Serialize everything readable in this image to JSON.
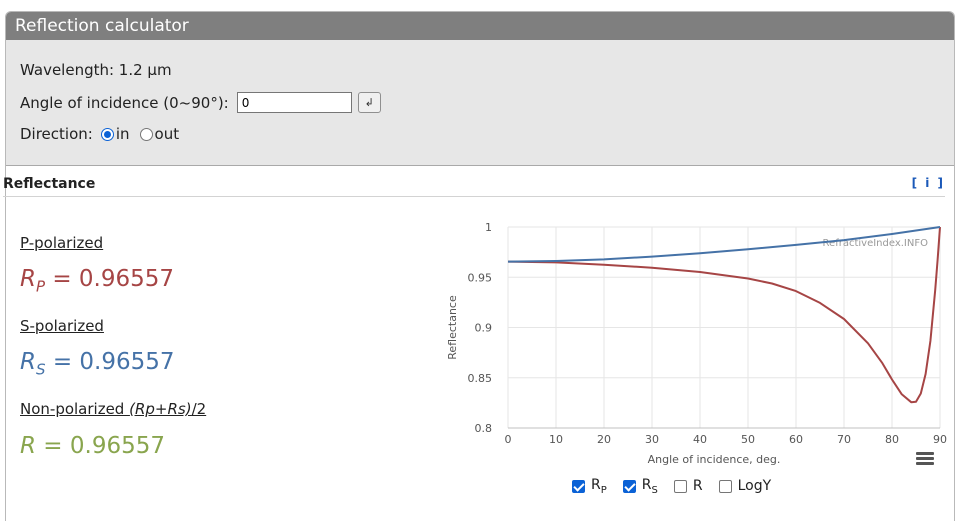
{
  "window": {
    "title": "Reflection calculator"
  },
  "params": {
    "wavelength_label": "Wavelength: 1.2 µm",
    "angle_label": "Angle of incidence (0~90°):",
    "angle_value": "0",
    "enter_symbol": "↲",
    "direction_label": "Direction:",
    "direction_options": [
      "in",
      "out"
    ],
    "direction_selected": "in"
  },
  "reflectance": {
    "title": "Reflectance",
    "info": "[ i ]",
    "p_label": "P-polarized",
    "p_symbol": "R",
    "p_sub": "P",
    "p_value": "= 0.96557",
    "s_label": "S-polarized",
    "s_symbol": "R",
    "s_sub": "S",
    "s_value": "= 0.96557",
    "n_label_prefix": "Non-polarized ",
    "n_label_formula": "(Rp+Rs)",
    "n_label_suffix": "/2",
    "n_symbol": "R",
    "n_value": "= 0.96557"
  },
  "legend": {
    "rp_main": "R",
    "rp_sub": "P",
    "rp_checked": true,
    "rs_main": "R",
    "rs_sub": "S",
    "rs_checked": true,
    "r_label": "R",
    "r_checked": false,
    "logy_label": "LogY",
    "logy_checked": false
  },
  "colors": {
    "p": "#a64545",
    "s": "#4572a7",
    "r": "#89a54e"
  },
  "chart_data": {
    "type": "line",
    "xlabel": "Angle of incidence, deg.",
    "ylabel": "Reflectance",
    "watermark": "RefractiveIndex.INFO",
    "xlim": [
      0,
      90
    ],
    "ylim": [
      0.8,
      1
    ],
    "xticks": [
      0,
      10,
      20,
      30,
      40,
      50,
      60,
      70,
      80,
      90
    ],
    "yticks": [
      0.8,
      0.85,
      0.9,
      0.95,
      1
    ],
    "ytick_labels": [
      "0.8",
      "0.85",
      "0.9",
      "0.95",
      "1"
    ],
    "grid": true,
    "series": [
      {
        "name": "Rp",
        "color": "#a64545",
        "x": [
          0,
          10,
          20,
          30,
          40,
          50,
          55,
          60,
          65,
          70,
          75,
          78,
          80,
          82,
          84,
          85,
          86,
          87,
          88,
          89,
          89.5,
          90
        ],
        "y": [
          0.9656,
          0.9648,
          0.9625,
          0.9595,
          0.9552,
          0.9488,
          0.9438,
          0.9362,
          0.9245,
          0.9085,
          0.8843,
          0.8645,
          0.8483,
          0.8337,
          0.8257,
          0.8262,
          0.8343,
          0.8537,
          0.8866,
          0.9372,
          0.9672,
          1.0
        ]
      },
      {
        "name": "Rs",
        "color": "#4572a7",
        "x": [
          0,
          10,
          20,
          30,
          40,
          50,
          60,
          70,
          80,
          90
        ],
        "y": [
          0.9656,
          0.9662,
          0.9678,
          0.9705,
          0.9738,
          0.9778,
          0.9822,
          0.987,
          0.993,
          1.0
        ]
      }
    ]
  }
}
